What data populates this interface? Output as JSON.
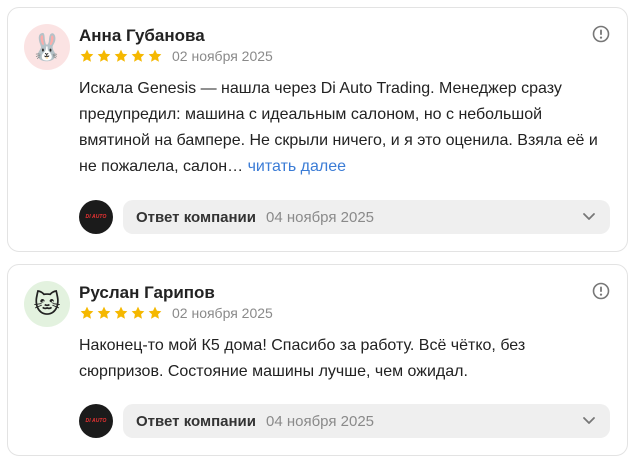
{
  "reviews": [
    {
      "avatar_emoji": "🐰",
      "avatar_icon": "rabbit-icon",
      "avatar_bg": "#fbe3e3",
      "name": "Анна Губанова",
      "rating": 5,
      "date": "02 ноября 2025",
      "text": "Искала Genesis — нашла через Di Auto Trading. Менеджер сразу предупредил: машина с идеальным салоном, но с небольшой вмятиной на бампере. Не скрыли ничего, и я это оценила. Взяла её и не пожалела, салон… ",
      "more_label": "читать далее",
      "reply_label": "Ответ компании",
      "reply_date": "04 ноября 2025"
    },
    {
      "avatar_emoji": "🐱",
      "avatar_icon": "cat-icon",
      "avatar_bg": "#e3f2df",
      "name": "Руслан Гарипов",
      "rating": 5,
      "date": "02 ноября 2025",
      "text": "Наконец-то мой К5 дома! Спасибо за работу. Всё чётко, без сюрпризов. Состояние машины лучше, чем ожидал.",
      "reply_label": "Ответ компании",
      "reply_date": "04 ноября 2025"
    }
  ],
  "colors": {
    "star": "#f5b800",
    "link": "#3b7cd6",
    "muted": "#8a8a8a",
    "reply_bg": "#efefef"
  },
  "company_logo_text": "DI AUTO"
}
